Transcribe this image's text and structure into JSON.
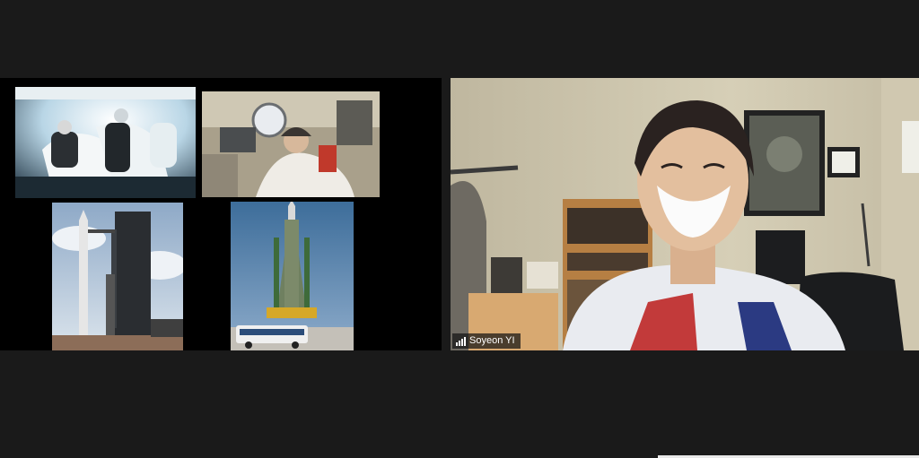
{
  "participant": {
    "name": "Soyeon YI",
    "signal_icon": "signal-bars-icon"
  },
  "colors": {
    "background": "#1a1a1a",
    "share_background": "#000000"
  },
  "shared_images": [
    {
      "id": "spacecraft-cabin-photo"
    },
    {
      "id": "soyuz-cabin-photo"
    },
    {
      "id": "rocket-launchpad-photo"
    },
    {
      "id": "soyuz-rocket-photo"
    }
  ]
}
